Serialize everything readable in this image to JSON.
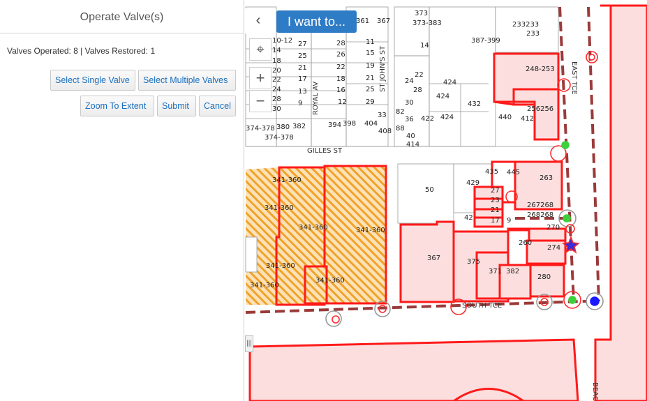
{
  "panel": {
    "title": "Operate Valve(s)",
    "status": "Valves Operated: 8 | Valves Restored: 1",
    "buttons": {
      "select_single": "Select Single Valve",
      "select_multiple": "Select Multiple Valves",
      "zoom_to_extent": "Zoom To Extent",
      "submit": "Submit",
      "cancel": "Cancel"
    }
  },
  "map": {
    "i_want_to": "I want to...",
    "collapse_glyph": "‹",
    "locate_glyph": "⌖",
    "zoom_in_glyph": "+",
    "zoom_out_glyph": "−",
    "handle_glyph": "|||",
    "streets": {
      "gilles": "GILLES ST",
      "royal": "ROYAL AV",
      "st_johns": "ST JOHN'S ST",
      "east": "EAST TCE",
      "south": "SOUTH TCE",
      "beach": "BEAC"
    },
    "parcel_labels": {
      "a1": "373",
      "a2": "373-383",
      "a3": "361",
      "a4": "367",
      "a5": "233233",
      "a6": "233",
      "a7": "10-12",
      "a8": "27",
      "a9": "28",
      "a10": "11",
      "a11": "14",
      "a12": "387-399",
      "a13": "14",
      "a14": "25",
      "a15": "26",
      "a16": "15",
      "a17": "248-253",
      "a18": "18",
      "a19": "21",
      "a20": "22",
      "a21": "19",
      "a22": "20",
      "a23": "22",
      "a24": "17",
      "a25": "18",
      "a26": "21",
      "a27": "22",
      "a28": "24",
      "a29": "424",
      "a30": "24",
      "a31": "13",
      "a32": "16",
      "a33": "25",
      "a34": "28",
      "a35": "424",
      "a36": "256256",
      "a37": "28",
      "a38": "9",
      "a39": "12",
      "a40": "29",
      "a41": "30",
      "a42": "432",
      "a43": "30",
      "a44": "82",
      "a45": "36",
      "a46": "422",
      "a47": "424",
      "a48": "440",
      "a49": "412",
      "a50": "33",
      "a51": "374-378",
      "a52": "380",
      "a53": "382",
      "a54": "394",
      "a55": "398",
      "a56": "404",
      "a57": "408",
      "a58": "88",
      "a59": "40",
      "a60": "374-378",
      "a61": "414",
      "b1": "435",
      "b2": "445",
      "b3": "263",
      "b4": "429",
      "b5": "50",
      "b6": "27",
      "b7": "23",
      "b8": "267268",
      "b9": "268268",
      "b10": "21",
      "b11": "42",
      "b12": "17",
      "b13": "9",
      "b14": "270",
      "b15": "260",
      "b16": "274",
      "b17": "367",
      "b18": "375",
      "b19": "371",
      "b20": "382",
      "b21": "280",
      "c1": "341-360",
      "c2": "341-360",
      "c3": "341-360",
      "c4": "341-360",
      "c5": "341-360",
      "c6": "341-360",
      "c7": "341-360"
    }
  },
  "colors": {
    "accent": "#2f7cc6",
    "parcel_highlight": "#ff1a1a",
    "parcel_fill": "#fbd9d9",
    "hatch_orange": "#f5a623",
    "valve_green": "#3cd13c",
    "valve_blue": "#1a1aff",
    "pipe_dash": "#9b3a3a"
  }
}
